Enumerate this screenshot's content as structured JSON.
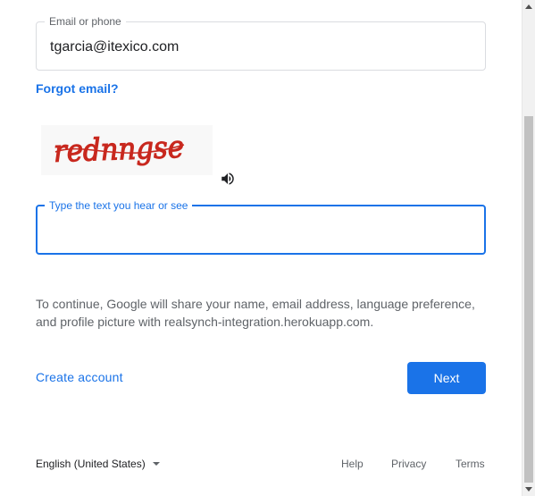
{
  "email_field": {
    "label": "Email or phone",
    "value": "tgarcia@itexico.com"
  },
  "forgot_email": "Forgot email?",
  "captcha": {
    "image_text": "rednngse",
    "audio_icon": "volume-icon",
    "input_label": "Type the text you hear or see",
    "input_value": ""
  },
  "disclaimer": "To continue, Google will share your name, email address, language preference, and profile picture with realsynch-integration.herokuapp.com.",
  "actions": {
    "create_account": "Create account",
    "next": "Next"
  },
  "footer": {
    "language": "English (United States)",
    "help": "Help",
    "privacy": "Privacy",
    "terms": "Terms"
  },
  "colors": {
    "accent": "#1a73e8",
    "text_secondary": "#5f6368",
    "border": "#dadce0",
    "captcha_red": "#c8281e"
  }
}
